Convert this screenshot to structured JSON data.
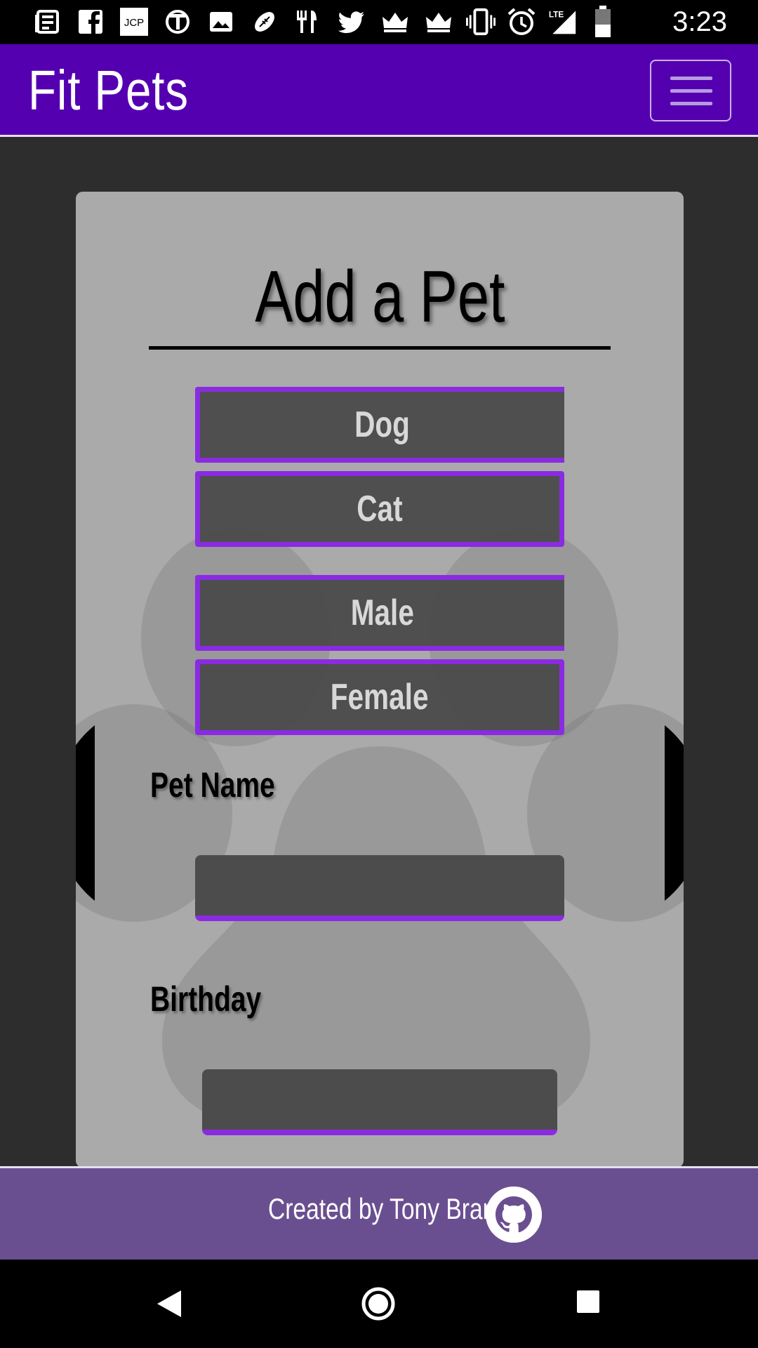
{
  "status_bar": {
    "left_icons": [
      "news-icon",
      "facebook-icon",
      "jcp-icon",
      "nyt-icon",
      "image-icon",
      "football-icon",
      "restaurant-icon",
      "twitter-icon",
      "crown-icon",
      "crown-icon"
    ],
    "right_icons": [
      "vibrate-icon",
      "alarm-icon",
      "lte-signal-icon",
      "battery-icon"
    ],
    "time": "3:23"
  },
  "app_bar": {
    "brand": "Fit Pets",
    "menu_icon": "hamburger-icon",
    "color": "#5500b0"
  },
  "form": {
    "title": "Add a Pet",
    "species_options": [
      "Dog",
      "Cat"
    ],
    "gender_options": [
      "Male",
      "Female"
    ],
    "pet_name_label": "Pet Name",
    "pet_name_value": "",
    "birthday_label": "Birthday",
    "birthday_value": "",
    "accent": "#8a2be2"
  },
  "footer": {
    "credit": "Created by Tony Brancato",
    "icon": "github-icon",
    "color": "#6a4f90"
  },
  "nav_bar": {
    "icons": [
      "back-icon",
      "home-icon",
      "recents-icon"
    ]
  }
}
